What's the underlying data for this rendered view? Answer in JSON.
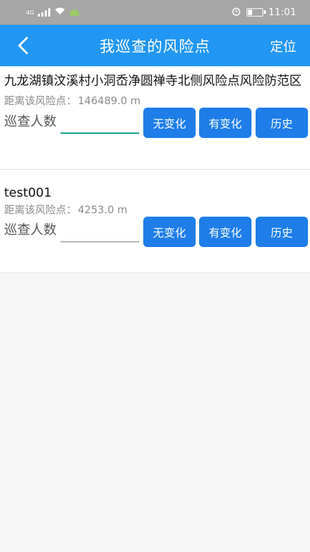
{
  "status_bar": {
    "network": "4G",
    "time": "11:01",
    "icons": [
      "signal-icon",
      "wifi-icon",
      "android-icon",
      "alarm-icon",
      "battery-icon"
    ]
  },
  "header": {
    "title": "我巡查的风险点",
    "locate_label": "定位",
    "back_icon": "chevron-left-icon"
  },
  "colors": {
    "header_bg": "#2196f3",
    "button_bg": "#1e7de8",
    "input_focus": "#1a9c88"
  },
  "risk_points": [
    {
      "name": "九龙湖镇汶溪村小洞岙净圆禅寺北侧风险点风险防范区",
      "distance_label": "距离该风险点：",
      "distance_value": "146489.0 m",
      "inspector_label": "巡查人数",
      "inspector_value": "",
      "btn_no_change": "无变化",
      "btn_changed": "有变化",
      "btn_history": "历史"
    },
    {
      "name": "test001",
      "distance_label": "距离该风险点：",
      "distance_value": "4253.0 m",
      "inspector_label": "巡查人数",
      "inspector_value": "",
      "btn_no_change": "无变化",
      "btn_changed": "有变化",
      "btn_history": "历史"
    }
  ]
}
